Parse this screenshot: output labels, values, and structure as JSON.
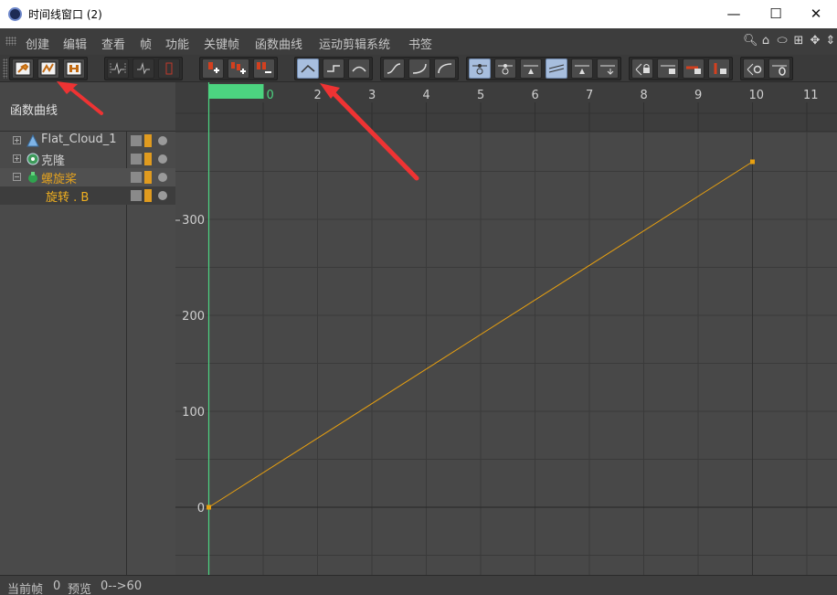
{
  "window": {
    "title": "时间线窗口 (2)",
    "minimize": "—",
    "maximize": "☐",
    "close": "✕"
  },
  "menu": [
    "创建",
    "编辑",
    "查看",
    "帧",
    "功能",
    "关键帧",
    "函数曲线",
    "运动剪辑系统",
    "书签"
  ],
  "menu_right_icons": [
    "magnifier-icon",
    "home-icon",
    "ellipse-icon",
    "frame-all-icon",
    "move-icon",
    "move-vertical-icon"
  ],
  "left_panel": {
    "header": "函数曲线",
    "tracks": [
      {
        "name": "Flat_Cloud_1",
        "icon": "cloud-object-icon",
        "expander": "⊞",
        "color": "#d0d0d0"
      },
      {
        "name": "克隆",
        "icon": "cloner-icon",
        "expander": "⊞",
        "color": "#d0d0d0"
      },
      {
        "name": "螺旋桨",
        "icon": "propeller-icon",
        "expander": "⊟",
        "color": "#e0a020"
      },
      {
        "name": "旋转 . B",
        "icon": "",
        "expander": "",
        "color": "#f0b020"
      }
    ]
  },
  "timeline": {
    "frame_labels": [
      "0",
      "2",
      "3",
      "4",
      "5",
      "6",
      "7",
      "8",
      "9",
      "10",
      "11"
    ],
    "y_labels": [
      "300",
      "200",
      "100",
      "0"
    ],
    "current_frame": 0,
    "accent": "#4cd480",
    "curve_color": "#e8a010"
  },
  "status": {
    "frame_label": "当前帧",
    "frame_value": "0",
    "preview_label": "预览",
    "preview_value": "0-->60"
  }
}
